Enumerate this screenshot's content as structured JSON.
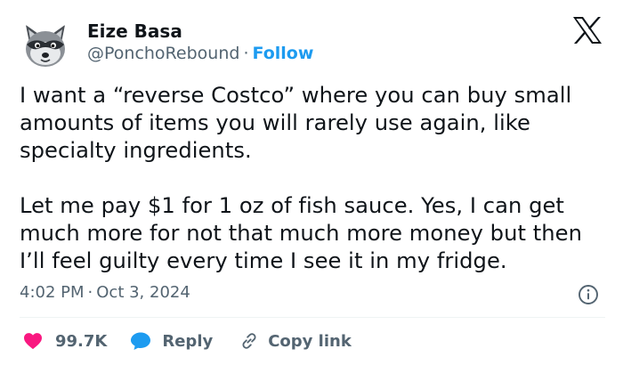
{
  "author": {
    "display_name": "Eize Basa",
    "handle": "@PonchoRebound",
    "separator": "·",
    "follow_label": "Follow"
  },
  "platform": {
    "logo_icon": "x-logo-icon"
  },
  "tweet": {
    "paragraph_1": "I want a “reverse Costco” where you can buy small amounts of items you will rarely use again, like specialty ingredients.",
    "paragraph_2": "Let me pay $1 for 1 oz of fish sauce. Yes, I can get much more for not that much more money but then I’ll feel guilty every time I see it in my fridge.",
    "time": "4:02 PM",
    "separator": "·",
    "date": "Oct 3, 2024"
  },
  "actions": {
    "like_count": "99.7K",
    "reply_label": "Reply",
    "copy_link_label": "Copy link"
  },
  "colors": {
    "text_primary": "#0f1419",
    "text_secondary": "#536471",
    "accent_blue": "#1d9bf0",
    "like_red": "#f91880",
    "divider": "#eff3f4"
  }
}
